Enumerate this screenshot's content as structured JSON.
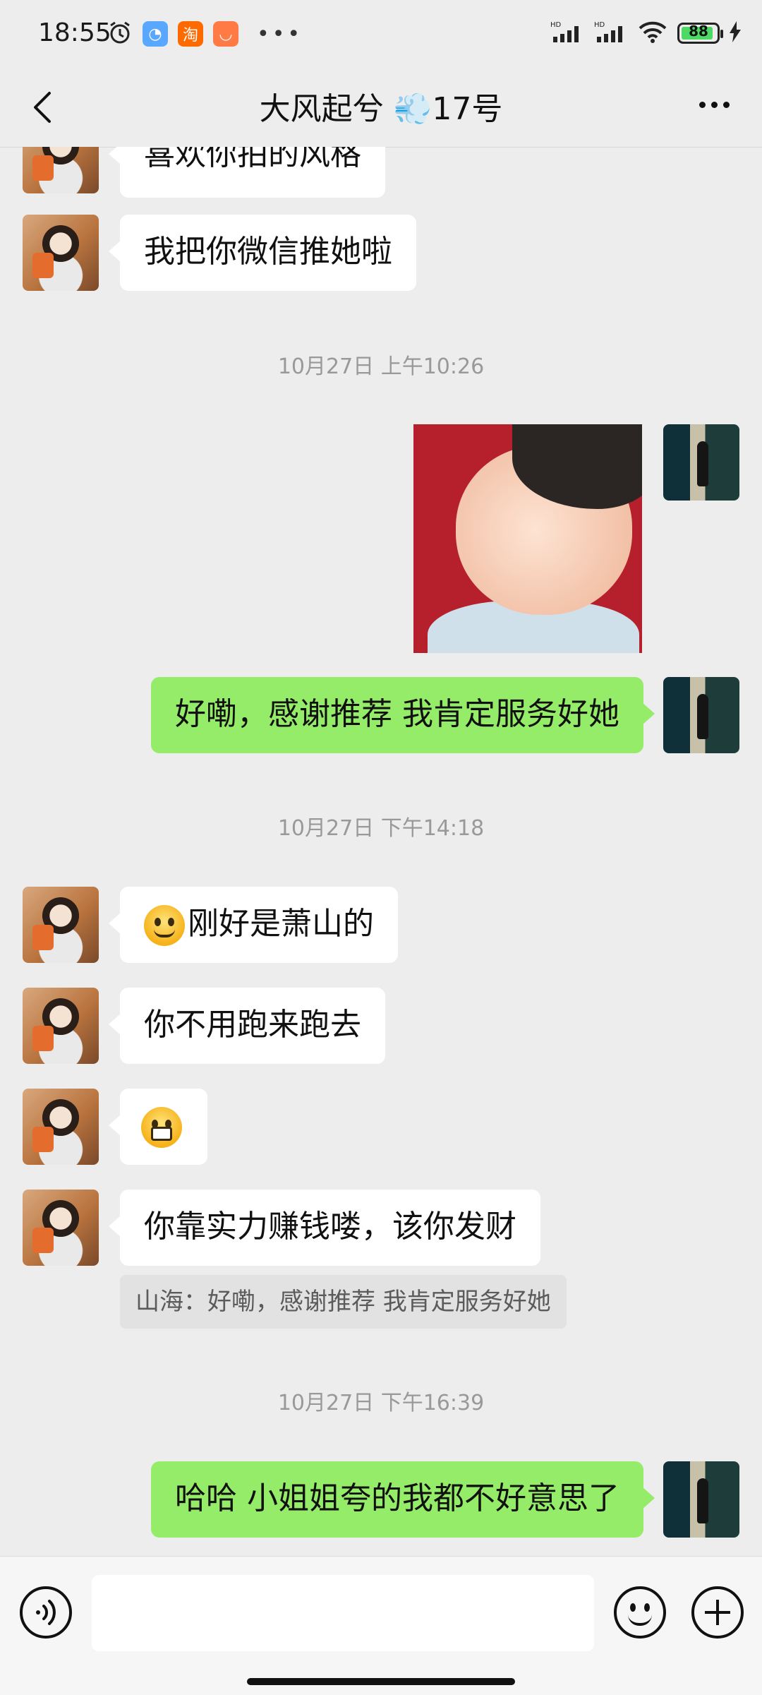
{
  "status_bar": {
    "time": "18:55",
    "network": "HD",
    "battery": "88"
  },
  "header": {
    "title": "大风起兮 💨17号"
  },
  "messages": {
    "m0": "喜欢你拍的风格",
    "m1": "我把你微信推她啦",
    "ts1": "10月27日 上午10:26",
    "m2": "好嘞，感谢推荐 我肯定服务好她",
    "ts2": "10月27日 下午14:18",
    "m3": "刚好是萧山的",
    "m4": "你不用跑来跑去",
    "m6": "你靠实力赚钱喽，该你发财",
    "quote": "山海：好嘞，感谢推荐 我肯定服务好她",
    "ts3": "10月27日 下午16:39",
    "m7": "哈哈 小姐姐夸的我都不好意思了"
  },
  "icons": {
    "m3_prefix": "smirk-emoji",
    "m5": "grin-emoji",
    "sticker": "laughing-baby-sticker"
  },
  "colors": {
    "outgoing_bubble": "#95ec69",
    "incoming_bubble": "#ffffff",
    "background": "#ededed"
  },
  "input": {
    "value": ""
  }
}
